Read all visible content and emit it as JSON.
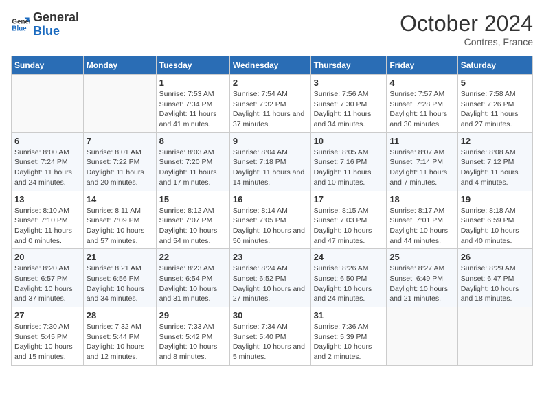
{
  "header": {
    "logo_general": "General",
    "logo_blue": "Blue",
    "month_title": "October 2024",
    "subtitle": "Contres, France"
  },
  "weekdays": [
    "Sunday",
    "Monday",
    "Tuesday",
    "Wednesday",
    "Thursday",
    "Friday",
    "Saturday"
  ],
  "weeks": [
    [
      {
        "num": "",
        "info": ""
      },
      {
        "num": "",
        "info": ""
      },
      {
        "num": "1",
        "info": "Sunrise: 7:53 AM\nSunset: 7:34 PM\nDaylight: 11 hours and 41 minutes."
      },
      {
        "num": "2",
        "info": "Sunrise: 7:54 AM\nSunset: 7:32 PM\nDaylight: 11 hours and 37 minutes."
      },
      {
        "num": "3",
        "info": "Sunrise: 7:56 AM\nSunset: 7:30 PM\nDaylight: 11 hours and 34 minutes."
      },
      {
        "num": "4",
        "info": "Sunrise: 7:57 AM\nSunset: 7:28 PM\nDaylight: 11 hours and 30 minutes."
      },
      {
        "num": "5",
        "info": "Sunrise: 7:58 AM\nSunset: 7:26 PM\nDaylight: 11 hours and 27 minutes."
      }
    ],
    [
      {
        "num": "6",
        "info": "Sunrise: 8:00 AM\nSunset: 7:24 PM\nDaylight: 11 hours and 24 minutes."
      },
      {
        "num": "7",
        "info": "Sunrise: 8:01 AM\nSunset: 7:22 PM\nDaylight: 11 hours and 20 minutes."
      },
      {
        "num": "8",
        "info": "Sunrise: 8:03 AM\nSunset: 7:20 PM\nDaylight: 11 hours and 17 minutes."
      },
      {
        "num": "9",
        "info": "Sunrise: 8:04 AM\nSunset: 7:18 PM\nDaylight: 11 hours and 14 minutes."
      },
      {
        "num": "10",
        "info": "Sunrise: 8:05 AM\nSunset: 7:16 PM\nDaylight: 11 hours and 10 minutes."
      },
      {
        "num": "11",
        "info": "Sunrise: 8:07 AM\nSunset: 7:14 PM\nDaylight: 11 hours and 7 minutes."
      },
      {
        "num": "12",
        "info": "Sunrise: 8:08 AM\nSunset: 7:12 PM\nDaylight: 11 hours and 4 minutes."
      }
    ],
    [
      {
        "num": "13",
        "info": "Sunrise: 8:10 AM\nSunset: 7:10 PM\nDaylight: 11 hours and 0 minutes."
      },
      {
        "num": "14",
        "info": "Sunrise: 8:11 AM\nSunset: 7:09 PM\nDaylight: 10 hours and 57 minutes."
      },
      {
        "num": "15",
        "info": "Sunrise: 8:12 AM\nSunset: 7:07 PM\nDaylight: 10 hours and 54 minutes."
      },
      {
        "num": "16",
        "info": "Sunrise: 8:14 AM\nSunset: 7:05 PM\nDaylight: 10 hours and 50 minutes."
      },
      {
        "num": "17",
        "info": "Sunrise: 8:15 AM\nSunset: 7:03 PM\nDaylight: 10 hours and 47 minutes."
      },
      {
        "num": "18",
        "info": "Sunrise: 8:17 AM\nSunset: 7:01 PM\nDaylight: 10 hours and 44 minutes."
      },
      {
        "num": "19",
        "info": "Sunrise: 8:18 AM\nSunset: 6:59 PM\nDaylight: 10 hours and 40 minutes."
      }
    ],
    [
      {
        "num": "20",
        "info": "Sunrise: 8:20 AM\nSunset: 6:57 PM\nDaylight: 10 hours and 37 minutes."
      },
      {
        "num": "21",
        "info": "Sunrise: 8:21 AM\nSunset: 6:56 PM\nDaylight: 10 hours and 34 minutes."
      },
      {
        "num": "22",
        "info": "Sunrise: 8:23 AM\nSunset: 6:54 PM\nDaylight: 10 hours and 31 minutes."
      },
      {
        "num": "23",
        "info": "Sunrise: 8:24 AM\nSunset: 6:52 PM\nDaylight: 10 hours and 27 minutes."
      },
      {
        "num": "24",
        "info": "Sunrise: 8:26 AM\nSunset: 6:50 PM\nDaylight: 10 hours and 24 minutes."
      },
      {
        "num": "25",
        "info": "Sunrise: 8:27 AM\nSunset: 6:49 PM\nDaylight: 10 hours and 21 minutes."
      },
      {
        "num": "26",
        "info": "Sunrise: 8:29 AM\nSunset: 6:47 PM\nDaylight: 10 hours and 18 minutes."
      }
    ],
    [
      {
        "num": "27",
        "info": "Sunrise: 7:30 AM\nSunset: 5:45 PM\nDaylight: 10 hours and 15 minutes."
      },
      {
        "num": "28",
        "info": "Sunrise: 7:32 AM\nSunset: 5:44 PM\nDaylight: 10 hours and 12 minutes."
      },
      {
        "num": "29",
        "info": "Sunrise: 7:33 AM\nSunset: 5:42 PM\nDaylight: 10 hours and 8 minutes."
      },
      {
        "num": "30",
        "info": "Sunrise: 7:34 AM\nSunset: 5:40 PM\nDaylight: 10 hours and 5 minutes."
      },
      {
        "num": "31",
        "info": "Sunrise: 7:36 AM\nSunset: 5:39 PM\nDaylight: 10 hours and 2 minutes."
      },
      {
        "num": "",
        "info": ""
      },
      {
        "num": "",
        "info": ""
      }
    ]
  ]
}
